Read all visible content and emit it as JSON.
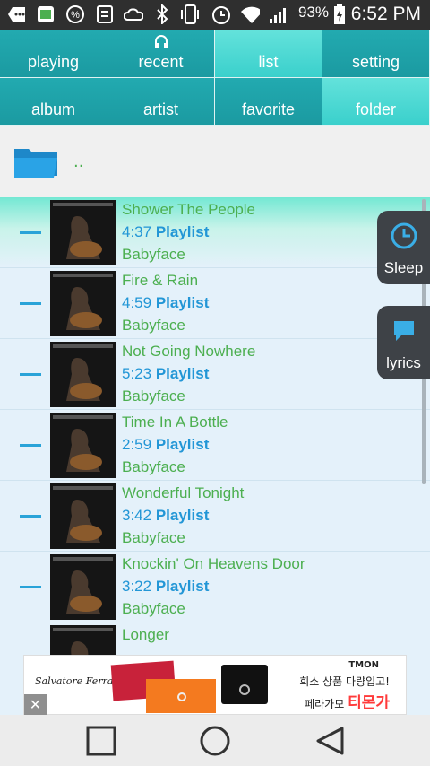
{
  "status_bar": {
    "battery_percent": "93%",
    "time": "6:52 PM",
    "icons": [
      "more-icon",
      "notes-icon",
      "percent-icon",
      "task-icon",
      "weather-icon",
      "bluetooth-icon",
      "vibrate-icon",
      "alarm-icon",
      "wifi-icon",
      "signal-icon",
      "battery-charging-icon"
    ]
  },
  "tabs": [
    {
      "label": "playing"
    },
    {
      "label": "recent",
      "icon": "headphones-icon"
    },
    {
      "label": "list"
    },
    {
      "label": "setting"
    },
    {
      "label": "album"
    },
    {
      "label": "artist"
    },
    {
      "label": "favorite"
    },
    {
      "label": "folder"
    }
  ],
  "folder": {
    "parent_label": "..",
    "icon": "folder-icon"
  },
  "tracks": [
    {
      "title": "Shower The People",
      "duration": "4:37",
      "playlist": "Playlist",
      "artist": "Babyface"
    },
    {
      "title": "Fire & Rain",
      "duration": "4:59",
      "playlist": "Playlist",
      "artist": "Babyface"
    },
    {
      "title": "Not Going Nowhere",
      "duration": "5:23",
      "playlist": "Playlist",
      "artist": "Babyface"
    },
    {
      "title": "Time In A Bottle",
      "duration": "2:59",
      "playlist": "Playlist",
      "artist": "Babyface"
    },
    {
      "title": "Wonderful Tonight",
      "duration": "3:42",
      "playlist": "Playlist",
      "artist": "Babyface"
    },
    {
      "title": "Knockin' On Heavens Door",
      "duration": "3:22",
      "playlist": "Playlist",
      "artist": "Babyface"
    },
    {
      "title": "Longer",
      "duration": "",
      "playlist": "",
      "artist": ""
    }
  ],
  "floating": {
    "sleep_label": "Sleep",
    "lyrics_label": "lyrics"
  },
  "ad": {
    "brand": "Salvatore Ferragamo",
    "tmon": "TMON",
    "line1": "희소 상품 다량입고!",
    "line2_prefix": "페라가모 ",
    "line2_accent": "티몬가",
    "close": "✕"
  },
  "colors": {
    "accent_teal": "#22aab0",
    "accent_light": "#3ad0cc",
    "title_green": "#4caf50",
    "duration_blue": "#2296d6"
  }
}
